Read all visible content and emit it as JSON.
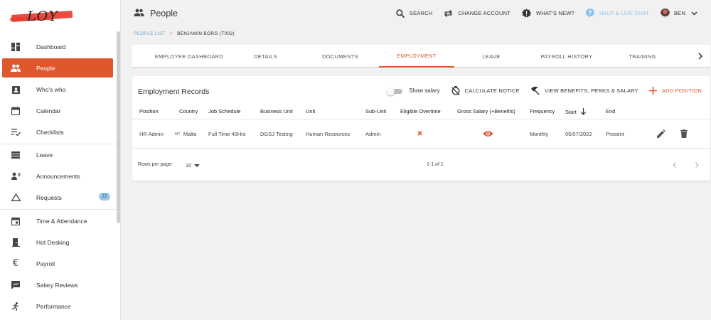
{
  "app": {
    "logo_text": "LOY"
  },
  "colors": {
    "accent": "#e0562d",
    "link": "#6aa6d6",
    "help": "#8fc2ec"
  },
  "sidebar": {
    "items": [
      {
        "label": "Dashboard",
        "icon": "dashboard-icon"
      },
      {
        "label": "People",
        "icon": "people-icon",
        "active": true
      },
      {
        "label": "Who's who",
        "icon": "contact-card-icon"
      },
      {
        "label": "Calendar",
        "icon": "calendar-icon"
      },
      {
        "label": "Checklists",
        "icon": "checklist-icon"
      },
      {
        "label": "Leave",
        "icon": "leave-icon"
      },
      {
        "label": "Announcements",
        "icon": "announcement-icon"
      },
      {
        "label": "Requests",
        "icon": "triangle-icon",
        "badge": "22"
      },
      {
        "label": "Time & Attendance",
        "icon": "time-attendance-icon"
      },
      {
        "label": "Hot Desking",
        "icon": "door-icon"
      },
      {
        "label": "Payroll",
        "icon": "euro-icon"
      },
      {
        "label": "Salary Reviews",
        "icon": "salary-review-icon"
      },
      {
        "label": "Performance",
        "icon": "running-icon"
      }
    ]
  },
  "header": {
    "title": "People",
    "search": "SEARCH",
    "change_account": "CHANGE ACCOUNT",
    "whats_new": "WHAT'S NEW?",
    "help": "HELP & LIVE CHAT",
    "user": "BEN"
  },
  "breadcrumb": {
    "parent": "PEOPLE LIST",
    "current": "BENJAMIN BORG (T002)"
  },
  "tabs": [
    "EMPLOYEE DASHBOARD",
    "DETAILS",
    "DOCUMENTS",
    "EMPLOYMENT",
    "LEAVE",
    "PAYROLL HISTORY",
    "TRAINING"
  ],
  "active_tab": "EMPLOYMENT",
  "card": {
    "title": "Employment Records",
    "show_salary": "Show salary",
    "calculate_notice": "CALCULATE NOTICE",
    "view_benefits": "VIEW BENEFITS, PERKS & SALARY",
    "add_position": "ADD POSITION"
  },
  "table": {
    "columns": [
      "Position",
      "Country",
      "Job Schedule",
      "Business Unit",
      "Unit",
      "Sub-Unit",
      "Eligible Overtime",
      "Gross Salary (+Benefits)",
      "Frequency",
      "Start",
      "End"
    ],
    "rows": [
      {
        "position": "HR Admin",
        "country_code": "MT",
        "country": "Malta",
        "job_schedule": "Full Time 40Hrs",
        "business_unit": "DGSJ Testing",
        "unit": "Human Resources",
        "sub_unit": "Admin",
        "eligible_overtime": "no",
        "frequency": "Monthly",
        "start": "05/07/2022",
        "end": "Present"
      }
    ]
  },
  "pagination": {
    "rows_per_page_label": "Rows per page:",
    "rows_per_page": "10",
    "range": "1-1 of 1"
  }
}
